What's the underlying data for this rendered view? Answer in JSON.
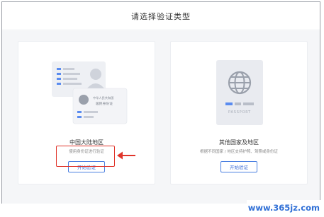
{
  "dialog": {
    "title": "请选择验证类型"
  },
  "cards": {
    "mainland": {
      "title": "中国大陆地区",
      "description": "使用身份证进行验证",
      "button_label": "开始验证",
      "id_card_text_line1": "中华人民共和国",
      "id_card_text_line2": "居民身份证"
    },
    "other": {
      "title": "其他国家及地区",
      "description": "根据不同国家 / 地区支持护照、驾照或身份证",
      "button_label": "开始验证",
      "passport_label": "PASSPORT"
    }
  },
  "watermark": "www.365jz.com",
  "colors": {
    "accent": "#3f6fd8",
    "highlight": "#e0352b"
  }
}
